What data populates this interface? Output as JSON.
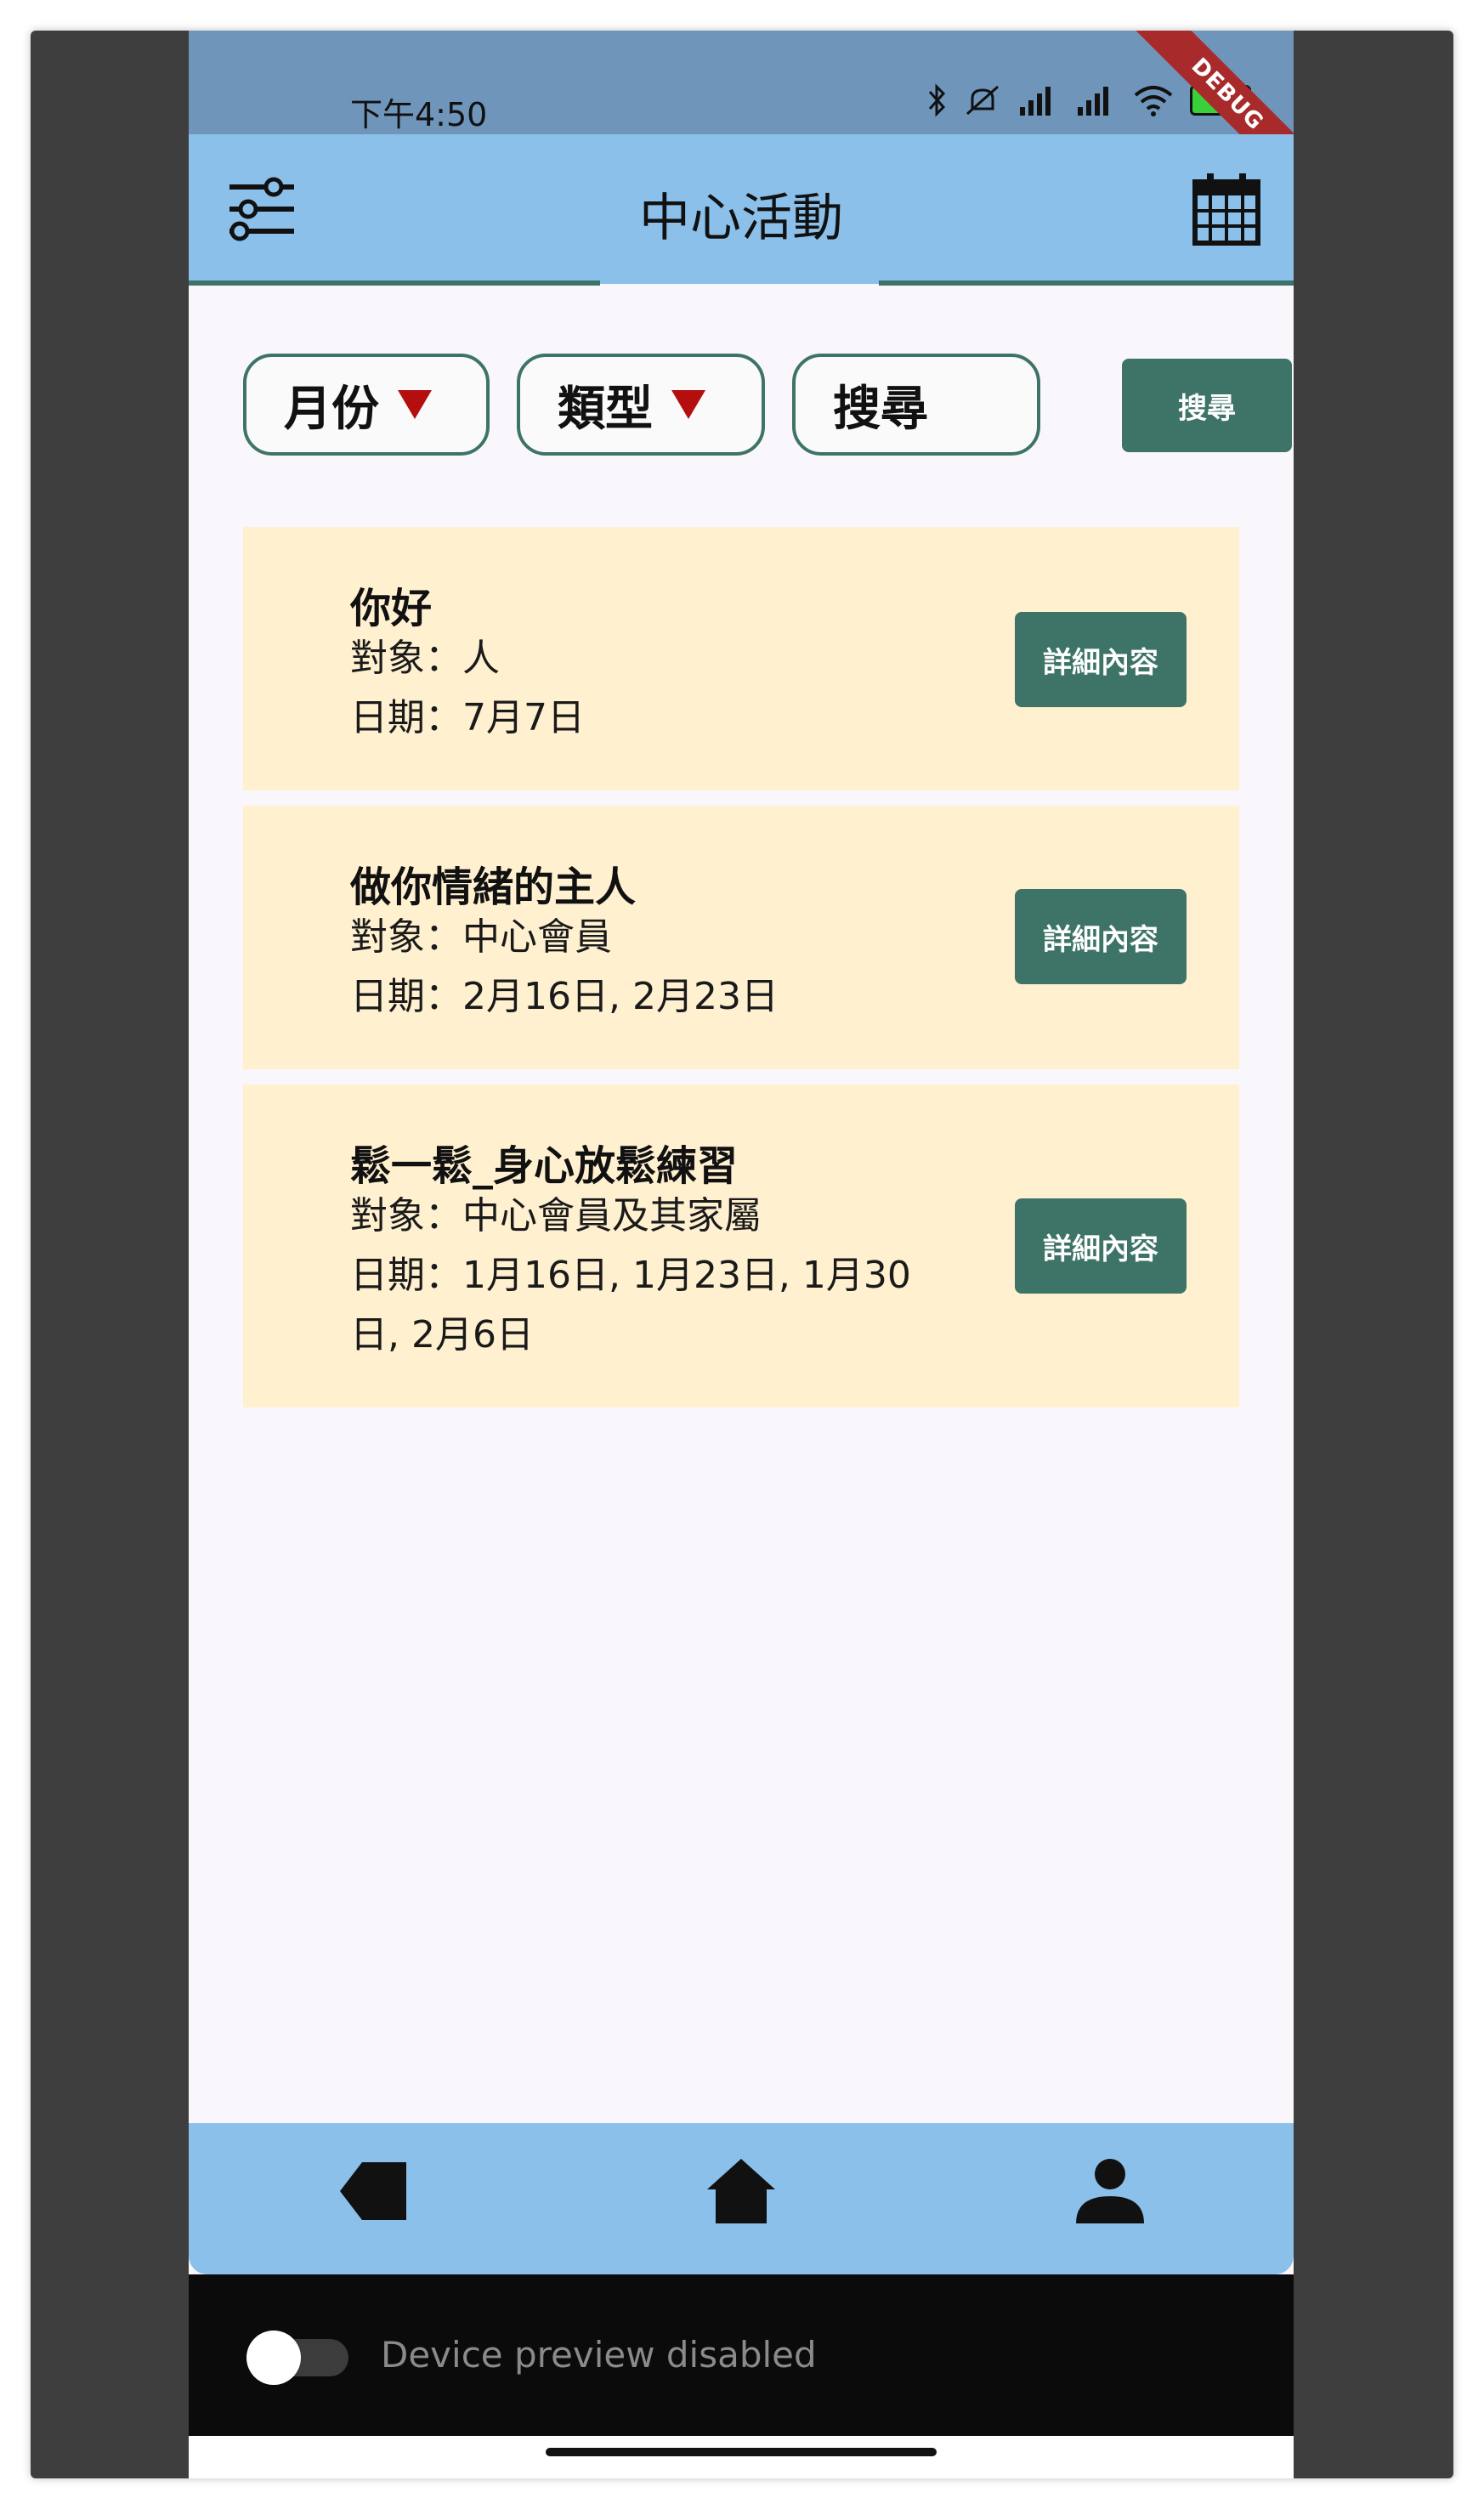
{
  "status_bar": {
    "time": "下午4:50",
    "battery": "89",
    "debug_banner": "DEBUG"
  },
  "app_bar": {
    "title": "中心活動",
    "left_icon": "filter-sliders-icon",
    "right_icon": "calendar-icon"
  },
  "filters": {
    "month_label": "月份",
    "type_label": "類型",
    "search_placeholder": "搜尋",
    "search_button": "搜尋"
  },
  "activities": [
    {
      "title": "你好",
      "target": "對象：人",
      "date": "日期：7月7日",
      "button": "詳細內容"
    },
    {
      "title": "做你情緒的主人",
      "target": "對象：中心會員",
      "date": "日期：2月16日, 2月23日",
      "button": "詳細內容"
    },
    {
      "title": "鬆一鬆_身心放鬆練習",
      "target": "對象：中心會員及其家屬",
      "date_line1": "日期：1月16日, 1月23日, 1月30",
      "date_line2": "日, 2月6日",
      "button": "詳細內容"
    }
  ],
  "bottom_nav": {
    "items": [
      "back-icon",
      "home-icon",
      "profile-icon"
    ]
  },
  "device_preview": {
    "label": "Device preview disabled"
  },
  "colors": {
    "appbar": "#8ac0ea",
    "accent": "#3e7467",
    "card": "#fff0d0",
    "dropdown_arrow": "#b50e0e"
  }
}
